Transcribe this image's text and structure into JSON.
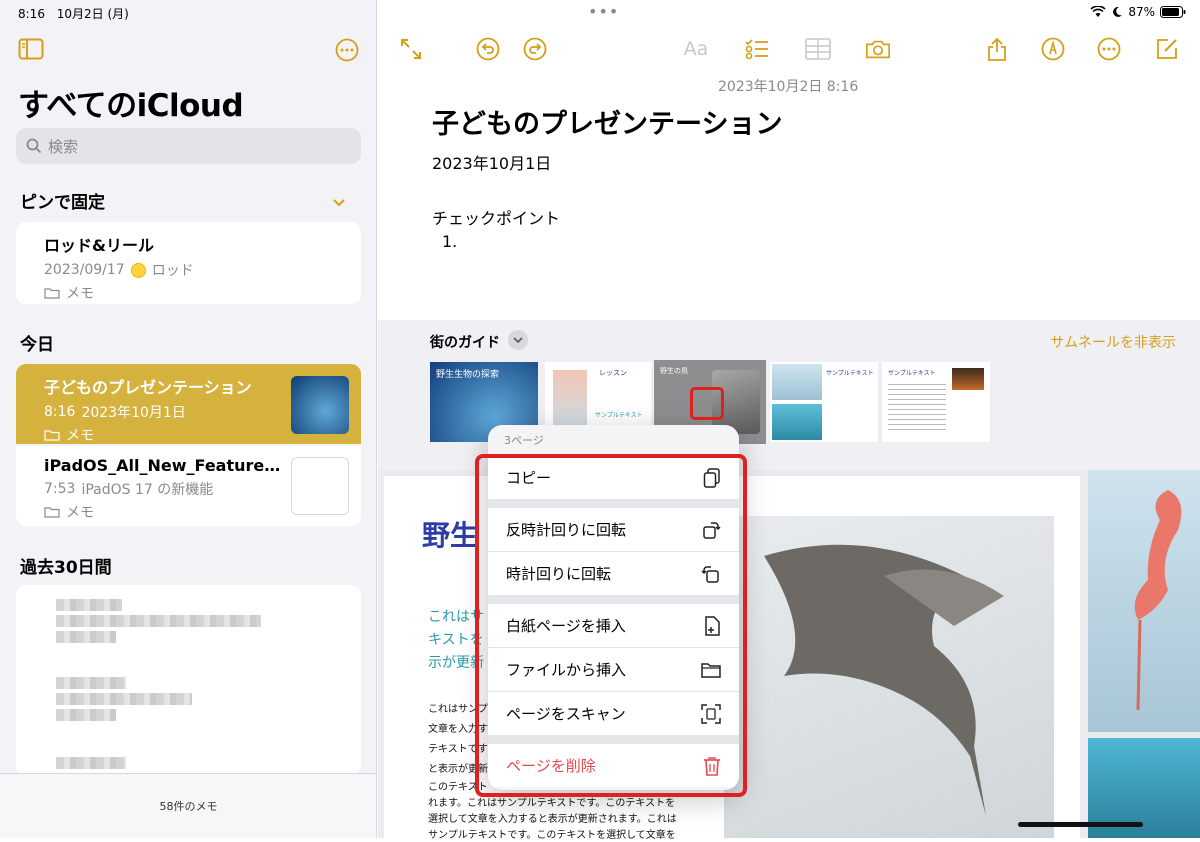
{
  "status": {
    "time": "8:16",
    "date": "10月2日 (月)",
    "battery": "87%"
  },
  "sidebar": {
    "title": "すべてのiCloud",
    "search_placeholder": "検索",
    "pinned_heading": "ピンで固定",
    "today_heading": "今日",
    "past30_heading": "過去30日間",
    "pinned_notes": [
      {
        "title": "ロッド&リール",
        "date": "2023/09/17",
        "tag": "ロッド",
        "folder": "メモ"
      }
    ],
    "today_notes": [
      {
        "title": "子どものプレゼンテーション",
        "time": "8:16",
        "preview": "2023年10月1日",
        "folder": "メモ",
        "selected": true
      },
      {
        "title": "iPadOS_All_New_Features...",
        "time": "7:53",
        "preview": "iPadOS 17 の新機能",
        "folder": "メモ",
        "selected": false
      }
    ],
    "footer": "58件のメモ"
  },
  "note": {
    "timestamp": "2023年10月2日 8:16",
    "title": "子どものプレゼンテーション",
    "date_line": "2023年10月1日",
    "checkpoint": "チェックポイント",
    "list_item": "1."
  },
  "pdf": {
    "name": "街のガイド",
    "hide_thumbnails": "サムネールを非表示",
    "thumb1_title": "野生生物の探索",
    "thumb2_title": "レッスン",
    "thumb3_title": "野生の鳥",
    "thumb4_title": "サンプルテキスト",
    "thumb5_title": "サンプルテキスト",
    "thumb2_caption": "サンプルテキスト"
  },
  "document": {
    "heading": "野生",
    "blue_lines": [
      "これはサ",
      "キストを",
      "示が更新"
    ],
    "small_lines": [
      "これはサンプ",
      "文章を入力す",
      "テキストです",
      "と表示が更新",
      "このテキスト",
      "れます。これはサンプルテキストです。このテキストを",
      "選択して文章を入力すると表示が更新されます。これは",
      "サンプルテキストです。このテキストを選択して文章を"
    ]
  },
  "context_menu": {
    "header": "3ページ",
    "items": {
      "copy": "コピー",
      "rotate_ccw": "反時計回りに回転",
      "rotate_cw": "時計回りに回転",
      "insert_blank": "白紙ページを挿入",
      "insert_file": "ファイルから挿入",
      "scan_page": "ページをスキャン",
      "delete_page": "ページを削除"
    }
  },
  "colors": {
    "accent": "#d4a017",
    "selected_row": "#d5b13d",
    "danger": "#e5484d",
    "highlight": "#e02020"
  }
}
